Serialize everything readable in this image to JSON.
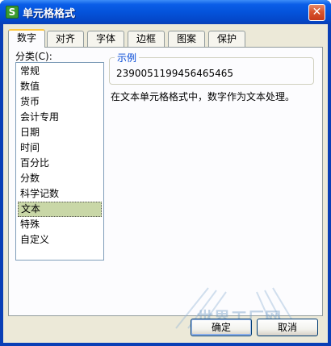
{
  "window": {
    "title": "单元格格式",
    "app_icon_letter": "S",
    "close_glyph": "✕"
  },
  "tabs": [
    {
      "label": "数字",
      "active": true
    },
    {
      "label": "对齐",
      "active": false
    },
    {
      "label": "字体",
      "active": false
    },
    {
      "label": "边框",
      "active": false
    },
    {
      "label": "图案",
      "active": false
    },
    {
      "label": "保护",
      "active": false
    }
  ],
  "category": {
    "label": "分类(C):",
    "items": [
      "常规",
      "数值",
      "货币",
      "会计专用",
      "日期",
      "时间",
      "百分比",
      "分数",
      "科学记数",
      "文本",
      "特殊",
      "自定义"
    ],
    "selected": "文本"
  },
  "sample": {
    "legend": "示例",
    "value": "2390051199456465465"
  },
  "description": "在文本单元格格式中，数字作为文本处理。",
  "buttons": {
    "ok": "确定",
    "cancel": "取消"
  },
  "watermark": "世界工厂网",
  "colors": {
    "titlebar": "#0453db",
    "dialog_bg": "#ece9d8",
    "active_tab_accent": "#ffc83c",
    "selection": "#c9d7a7",
    "sample_legend": "#0046d5"
  }
}
